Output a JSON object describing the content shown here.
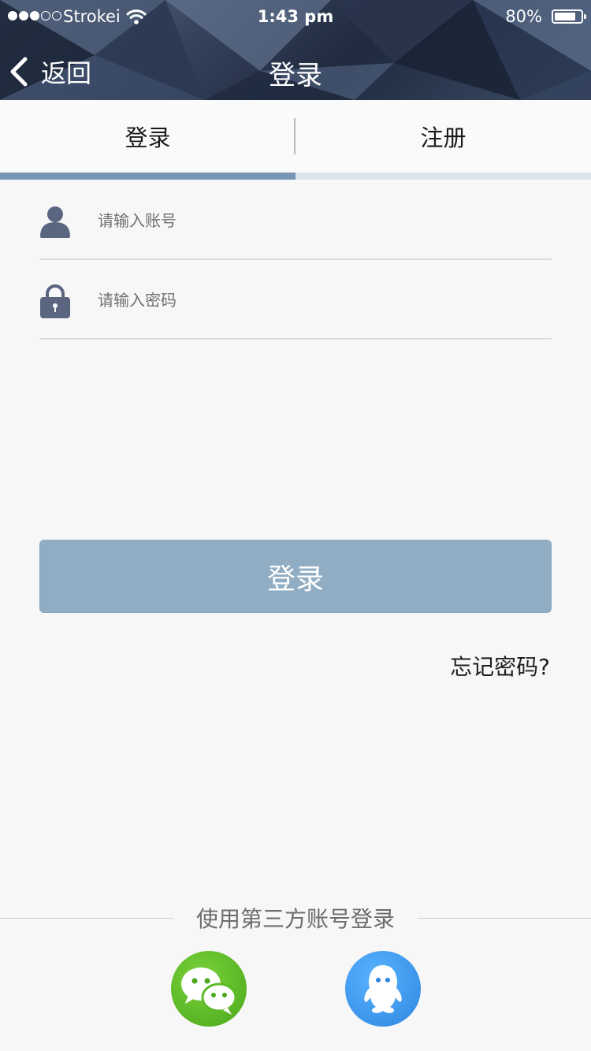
{
  "status_bar": {
    "carrier": "Strokei",
    "time": "1:43 pm",
    "battery_percent": "80%",
    "signal_bars_filled": 3,
    "signal_bars_total": 5,
    "battery_level": 0.8
  },
  "nav": {
    "back_label": "返回",
    "title": "登录"
  },
  "tabs": {
    "items": [
      {
        "label": "登录",
        "active": true
      },
      {
        "label": "注册",
        "active": false
      }
    ]
  },
  "form": {
    "account_placeholder": "请输入账号",
    "password_placeholder": "请输入密码",
    "account_value": "",
    "password_value": "",
    "submit_label": "登录",
    "forgot_label": "忘记密码?"
  },
  "third_party": {
    "title": "使用第三方账号登录",
    "providers": [
      {
        "icon": "wechat-icon",
        "color": "#5cba28"
      },
      {
        "icon": "qq-icon",
        "color": "#3d95ec"
      }
    ]
  },
  "colors": {
    "header_dark": "#1f2a3e",
    "tab_indicator": "#7796b5",
    "login_button": "#90adc4",
    "icon_color": "#5a6580"
  }
}
